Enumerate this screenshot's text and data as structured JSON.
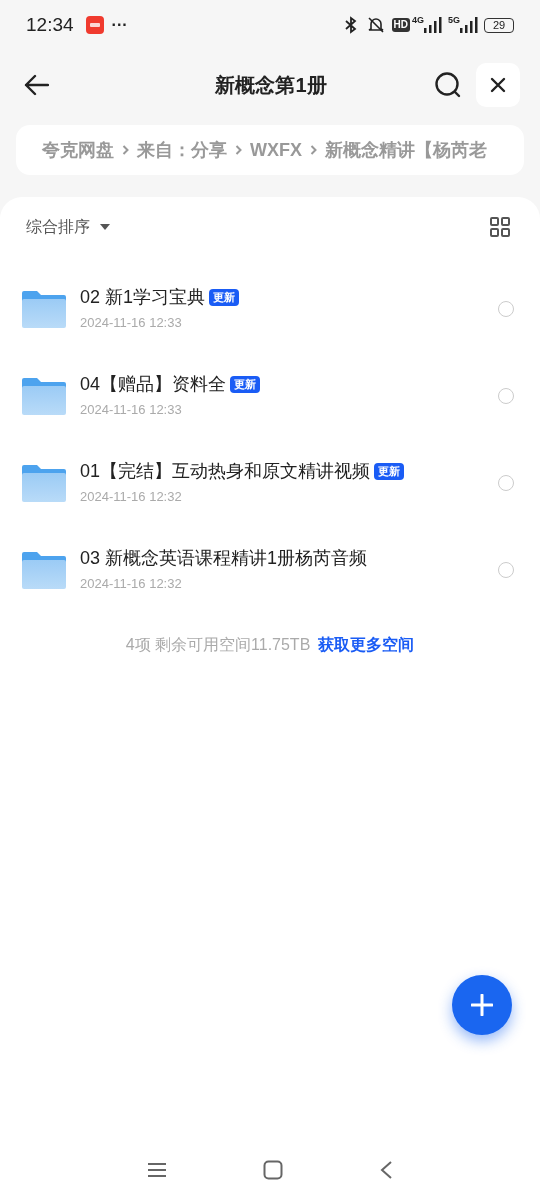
{
  "status_bar": {
    "time": "12:34",
    "more": "···",
    "hd": "HD",
    "net_1": "4G",
    "net_2": "5G",
    "battery": "29"
  },
  "header": {
    "title": "新概念第1册"
  },
  "breadcrumb": [
    "夸克网盘",
    "来自：分享",
    "WXFX",
    "新概念精讲【杨芮老"
  ],
  "toolbar": {
    "sort": "综合排序"
  },
  "files": [
    {
      "name": "02 新1学习宝典",
      "badge": "更新",
      "date": "2024-11-16 12:33",
      "selected": false
    },
    {
      "name": "04【赠品】资料全",
      "badge": "更新",
      "date": "2024-11-16 12:33",
      "selected": false
    },
    {
      "name": "01【完结】互动热身和原文精讲视频",
      "badge": "更新",
      "date": "2024-11-16 12:32",
      "selected": false
    },
    {
      "name": "03 新概念英语课程精讲1册杨芮音频",
      "date": "2024-11-16 12:32",
      "selected": false
    }
  ],
  "footer": {
    "summary": "4项 剩余可用空间11.75TB",
    "link": "获取更多空间"
  }
}
